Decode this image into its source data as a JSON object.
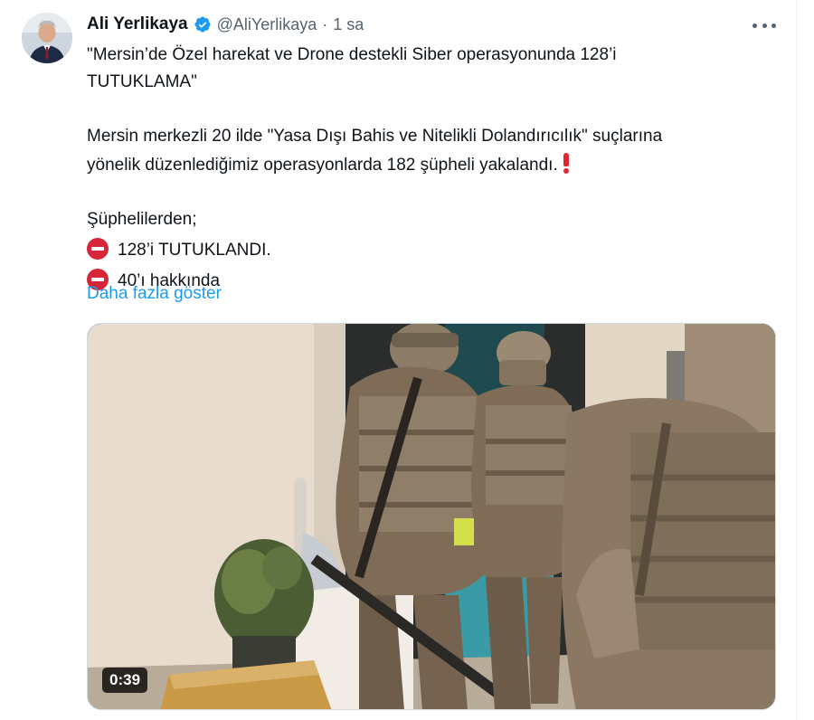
{
  "author": {
    "display_name": "Ali Yerlikaya",
    "handle": "@AliYerlikaya",
    "separator": "·",
    "time": "1 sa"
  },
  "tweet": {
    "lines": [
      "\"Mersin’de Özel harekat ve Drone destekli Siber operasyonunda 128’i",
      "TUTUKLAMA\"",
      "Mersin merkezli 20 ilde \"Yasa Dışı Bahis ve Nitelikli Dolandırıcılık\" suçlarına",
      "yönelik düzenlediğimiz operasyonlarda 182 şüpheli yakalandı.",
      "Şüphelilerden;",
      "128’i TUTUKLANDI.",
      "40’ı hakkında"
    ],
    "show_more": "Daha fazla göster"
  },
  "media": {
    "duration": "0:39"
  },
  "icons": {
    "verified": "verified-badge-icon",
    "more": "more-options-icon",
    "exclamation": "red-exclamation-icon",
    "no_entry": "no-entry-icon"
  },
  "colors": {
    "link": "#1d9bf0",
    "secondary_text": "#536471",
    "primary_text": "#0f1419",
    "verified": "#1d9bf0",
    "no_entry": "#d7263a"
  }
}
